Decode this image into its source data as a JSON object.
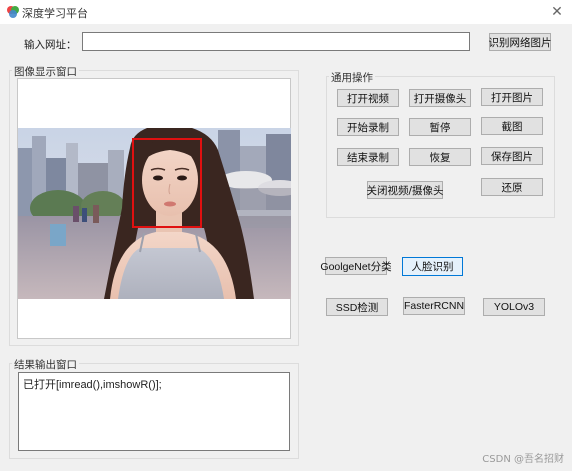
{
  "window": {
    "title": "深度学习平台",
    "close_glyph": "✕"
  },
  "url_bar": {
    "label": "输入网址：",
    "value": "",
    "recognize_button": "识别网络图片"
  },
  "image_panel": {
    "title": "图像显示窗口"
  },
  "ops_group": {
    "title": "通用操作",
    "buttons": {
      "open_video": "打开视频",
      "open_camera": "打开摄像头",
      "open_image": "打开图片",
      "start_record": "开始录制",
      "pause": "暂停",
      "screenshot": "截图",
      "stop_record": "结束录制",
      "resume": "恢复",
      "save_image": "保存图片",
      "close_video_camera": "关闭视频/摄像头",
      "restore": "还原"
    }
  },
  "model_buttons": {
    "googlenet": "GoolgeNet分类",
    "face": "人脸识别",
    "ssd": "SSD检测",
    "fasterrcnn": "FasterRCNN",
    "yolo": "YOLOv3"
  },
  "output_panel": {
    "title": "结果输出窗口",
    "text": "已打开[imread(),imshowR()];"
  },
  "watermark": "CSDN @吾名招财",
  "colors": {
    "face_box": "#e01010",
    "active_border": "#0078d7"
  }
}
